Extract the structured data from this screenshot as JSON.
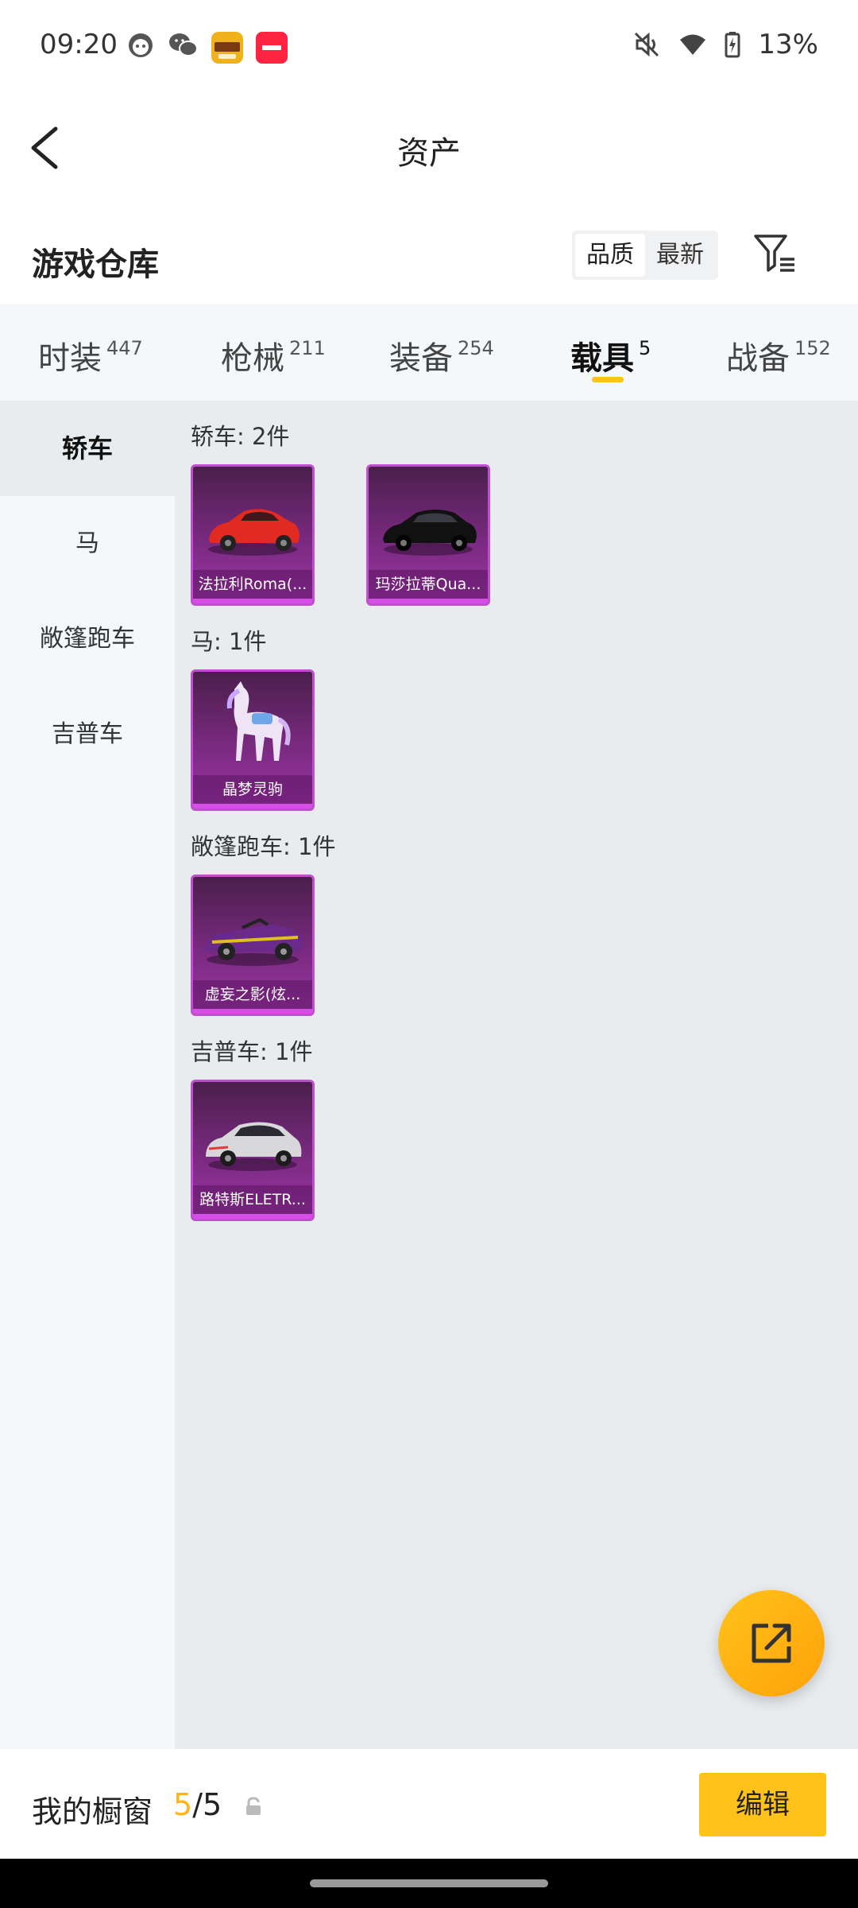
{
  "status_bar": {
    "time": "09:20",
    "battery": "13%",
    "icons": [
      "face-icon",
      "wechat-icon",
      "game-app-icon",
      "xiaohongshu-icon",
      "mute-icon",
      "wifi-icon",
      "battery-charging-icon"
    ],
    "app_badge_1": "王者荣耀",
    "app_badge_2": "小红书"
  },
  "header": {
    "title": "资产"
  },
  "warehouse": {
    "title": "游戏仓库",
    "sort_options": [
      "品质",
      "最新"
    ],
    "sort_selected": "品质"
  },
  "tabs": [
    {
      "label": "时装",
      "count": "447"
    },
    {
      "label": "枪械",
      "count": "211"
    },
    {
      "label": "装备",
      "count": "254"
    },
    {
      "label": "载具",
      "count": "5"
    },
    {
      "label": "战备",
      "count": "152"
    }
  ],
  "active_tab": "载具",
  "categories": [
    {
      "label": "轿车"
    },
    {
      "label": "马"
    },
    {
      "label": "敞篷跑车"
    },
    {
      "label": "吉普车"
    }
  ],
  "active_category": "轿车",
  "groups": [
    {
      "label": "轿车: 2件",
      "items": [
        {
          "name": "法拉利Roma(...",
          "icon": "red-sports-car-icon"
        },
        {
          "name": "玛莎拉蒂Qua...",
          "icon": "black-sedan-icon"
        }
      ]
    },
    {
      "label": "马: 1件",
      "items": [
        {
          "name": "晶梦灵驹",
          "icon": "crystal-horse-icon"
        }
      ]
    },
    {
      "label": "敞篷跑车: 1件",
      "items": [
        {
          "name": "虚妄之影(炫...",
          "icon": "purple-convertible-icon"
        }
      ]
    },
    {
      "label": "吉普车: 1件",
      "items": [
        {
          "name": "路特斯ELETR...",
          "icon": "white-suv-icon"
        }
      ]
    }
  ],
  "fab": {
    "icon": "share-external-icon"
  },
  "bottom_bar": {
    "label": "我的橱窗",
    "current": "5",
    "total": "/5",
    "lock_icon": "lock-icon",
    "edit_label": "编辑"
  },
  "colors": {
    "accent": "#ffc21a",
    "count_highlight": "#ffb41a",
    "card_purple": "#9d36a8",
    "content_bg": "#e8ecef",
    "tabs_bg": "#f5f8fb"
  }
}
